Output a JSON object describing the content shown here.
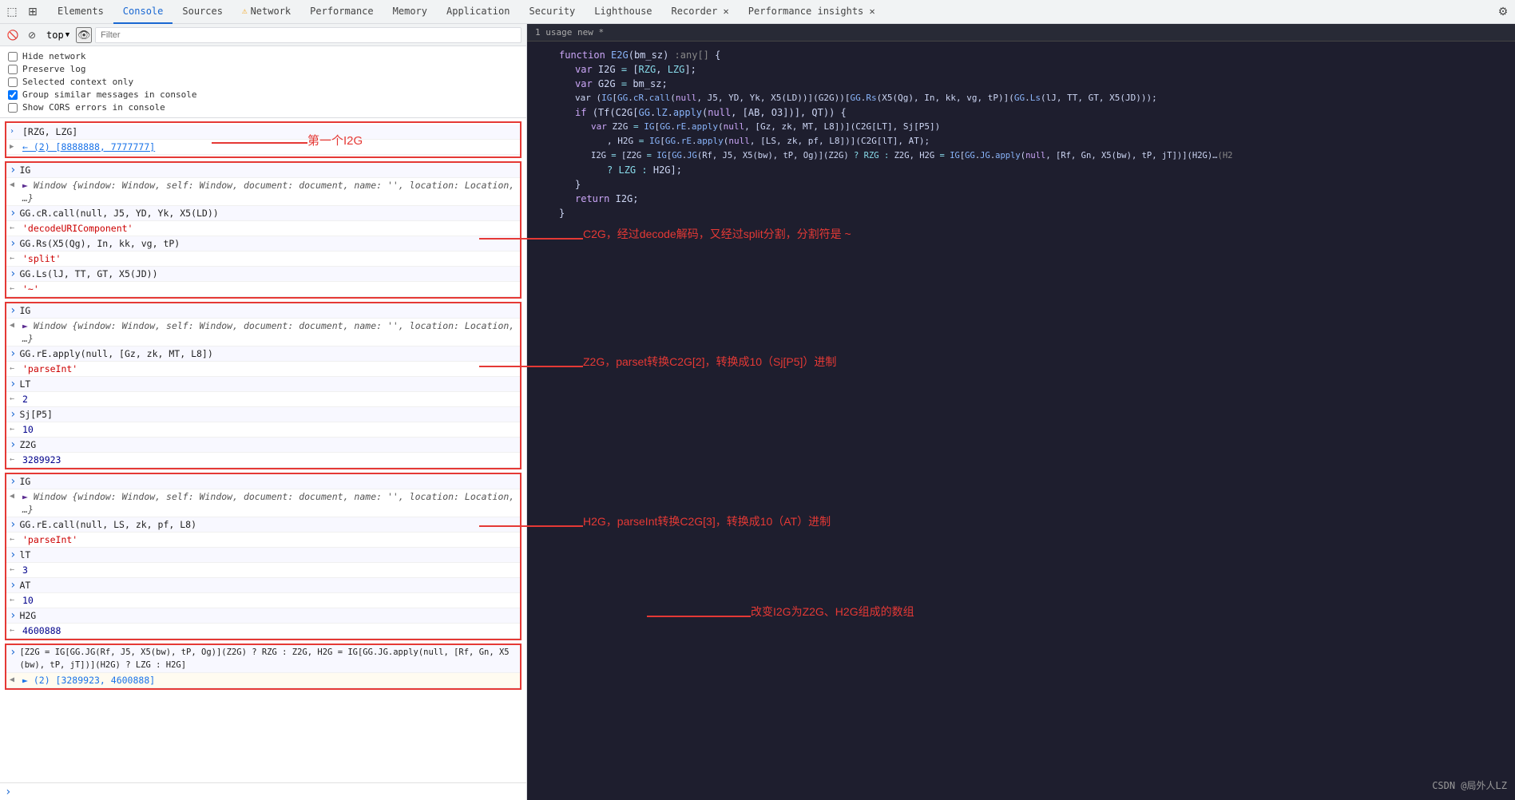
{
  "devtools": {
    "tabs": [
      {
        "label": "Elements",
        "active": false,
        "id": "elements"
      },
      {
        "label": "Console",
        "active": true,
        "id": "console"
      },
      {
        "label": "Sources",
        "active": false,
        "id": "sources"
      },
      {
        "label": "Network",
        "active": false,
        "id": "network",
        "warn": true
      },
      {
        "label": "Performance",
        "active": false,
        "id": "performance"
      },
      {
        "label": "Memory",
        "active": false,
        "id": "memory"
      },
      {
        "label": "Application",
        "active": false,
        "id": "application"
      },
      {
        "label": "Security",
        "active": false,
        "id": "security"
      },
      {
        "label": "Lighthouse",
        "active": false,
        "id": "lighthouse"
      },
      {
        "label": "Recorder ✕",
        "active": false,
        "id": "recorder"
      },
      {
        "label": "Performance insights ✕",
        "active": false,
        "id": "perf-insights"
      }
    ]
  },
  "console": {
    "toolbar": {
      "top_label": "top",
      "filter_placeholder": "Filter"
    },
    "options": [
      {
        "label": "Hide network",
        "checked": false
      },
      {
        "label": "Preserve log",
        "checked": false
      },
      {
        "label": "Selected context only",
        "checked": false
      },
      {
        "label": "Group similar messages in console",
        "checked": true
      },
      {
        "label": "Show CORS errors in console",
        "checked": false
      }
    ]
  },
  "code": {
    "header": "1 usage   new *",
    "lines": [
      "function E2G(bm_sz) :any[] {",
      "    var I2G = [RZG, LZG];",
      "    var G2G = bm_sz;",
      "    var (IG[GG.cR.call(null, J5, YD, Yk, X5(LD))](G2G))[GG.Rs(X5(Qg), In, kk, vg, tP)](GG.Ls(lJ, TT, GT, X5(JD)));",
      "    if (Tf(C2G[GG.lZ.apply(null, [AB, O3])], QT)) {",
      "        var Z2G = IG[GG.rE.apply(null, [Gz, zk, MT, L8])](C2G[LT], Sj[P5])",
      "            , H2G = IG[GG.rE.apply(null, [LS, zk, pf, L8])](C2G[lT], AT);",
      "        I2G = [Z2G = IG[GG.JG(Rf, J5, X5(bw), tP, Og)](Z2G) ? RZG : Z2G, H2G = IG[GG.JG.apply(null, [Rf, Gn, X5(bw), tP, jT])](H2G)",
      "            ? LZG : H2G];",
      "    }",
      "    return I2G;",
      "}"
    ]
  },
  "annotations": [
    {
      "text": "第一个I2G",
      "id": "ann1"
    },
    {
      "text": "C2G，经过decode解码，又经过split分割，分割符是 ~",
      "id": "ann2"
    },
    {
      "text": "Z2G，parset转换C2G[2]，转换成10（Sj[P5]）进制",
      "id": "ann3"
    },
    {
      "text": "H2G，parseInt转换C2G[3]，转换成10（AT）进制",
      "id": "ann4"
    },
    {
      "text": "改变I2G为Z2G、H2G组成的数组",
      "id": "ann5"
    }
  ],
  "watermark": "CSDN @局外人LZ",
  "console_rows": {
    "section1": {
      "rows": [
        {
          "type": "input",
          "content": "[RZG, LZG]"
        },
        {
          "type": "result-obj",
          "content": "► (2) [8888888, 7777777]"
        }
      ]
    },
    "main_rows": [
      {
        "type": "input",
        "content": "IG"
      },
      {
        "type": "result",
        "content": "► Window {window: Window, self: Window, document: document, name: '', location: Location, …}"
      },
      {
        "type": "input",
        "content": "GG.cR.call(null, J5, YD, Yk, X5(LD))"
      },
      {
        "type": "result-str",
        "content": "'decodeURIComponent'"
      },
      {
        "type": "input",
        "content": "GG.Rs(X5(Qg), In, kk, vg, tP)"
      },
      {
        "type": "result-str",
        "content": "'split'"
      },
      {
        "type": "input",
        "content": "GG.Ls(lJ, TT, GT, X5(JD))"
      },
      {
        "type": "result-str",
        "content": "'~'"
      }
    ],
    "section2_rows": [
      {
        "type": "input",
        "content": "IG"
      },
      {
        "type": "result",
        "content": "► Window {window: Window, self: Window, document: document, name: '', location: Location, …}"
      },
      {
        "type": "input",
        "content": "GG.rE.apply(null, [Gz, zk, MT, L8])"
      },
      {
        "type": "result-str",
        "content": "'parseInt'"
      },
      {
        "type": "input",
        "content": "LT"
      },
      {
        "type": "result-num",
        "content": "2"
      },
      {
        "type": "input",
        "content": "Sj[P5]"
      },
      {
        "type": "result-num",
        "content": "10"
      },
      {
        "type": "input",
        "content": "Z2G"
      },
      {
        "type": "result-num",
        "content": "3289923"
      }
    ],
    "section3_rows": [
      {
        "type": "input",
        "content": "IG"
      },
      {
        "type": "result",
        "content": "► Window {window: Window, self: Window, document: document, name: '', location: Location, …}"
      },
      {
        "type": "input",
        "content": "GG.rE.call(null, LS, zk, pf, L8)"
      },
      {
        "type": "result-str",
        "content": "'parseInt'"
      },
      {
        "type": "input",
        "content": "lT"
      },
      {
        "type": "result-num",
        "content": "3"
      },
      {
        "type": "input",
        "content": "AT"
      },
      {
        "type": "result-num",
        "content": "10"
      },
      {
        "type": "input",
        "content": "H2G"
      },
      {
        "type": "result-num",
        "content": "4600888"
      }
    ],
    "section4_rows": [
      {
        "type": "input-long",
        "content": "[Z2G = IG[GG.JG(Rf, J5, X5(bw), tP, Og)](Z2G) ? RZG : Z2G, H2G = IG[GG.JG.apply(null, [Rf, Gn, X5(bw), tP, jT])](H2G) ? LZG : H2G]"
      },
      {
        "type": "result-obj",
        "content": "► (2) [3289923, 4600888]"
      }
    ]
  }
}
